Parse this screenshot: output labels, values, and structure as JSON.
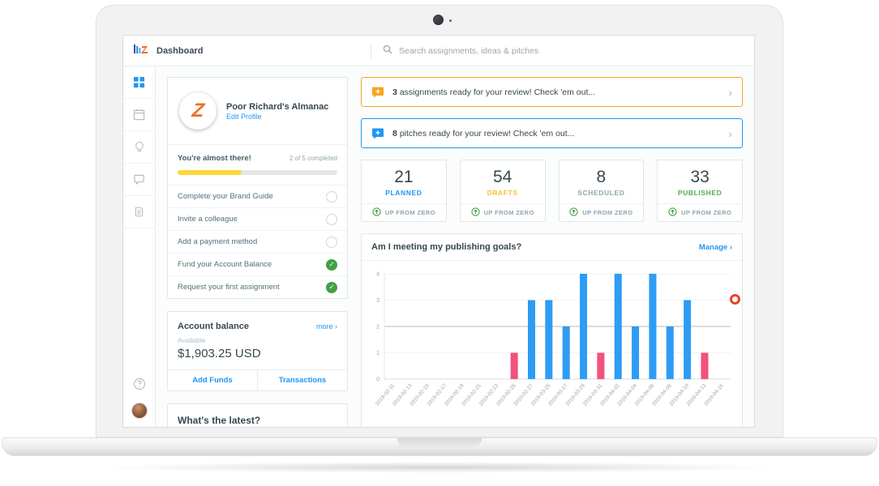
{
  "topbar": {
    "page_title": "Dashboard",
    "search_placeholder": "Search assignments, ideas & pitches"
  },
  "sidebar": {
    "items": [
      "dashboard",
      "calendar",
      "ideas",
      "pitches",
      "assignments"
    ],
    "active_item": "dashboard"
  },
  "profile_card": {
    "name": "Poor Richard's Almanac",
    "edit_link": "Edit Profile",
    "progress_title": "You're almost there!",
    "progress_status": "2 of 5 completed",
    "progress_percent": 40,
    "checklist": [
      {
        "label": "Complete your Brand Guide",
        "done": false
      },
      {
        "label": "Invite a colleague",
        "done": false
      },
      {
        "label": "Add a payment method",
        "done": false
      },
      {
        "label": "Fund your Account Balance",
        "done": true
      },
      {
        "label": "Request your first assignment",
        "done": true
      }
    ]
  },
  "balance_card": {
    "title": "Account balance",
    "more_link": "more ›",
    "available_label": "Available",
    "amount": "$1,903.25 USD",
    "buttons": {
      "add_funds": "Add Funds",
      "transactions": "Transactions"
    }
  },
  "latest_card": {
    "title": "What's the latest?"
  },
  "alerts": [
    {
      "count": "3",
      "text": "assignments ready for your review! Check 'em out...",
      "accent": "#f5a623"
    },
    {
      "count": "8",
      "text": "pitches ready for your review! Check 'em out...",
      "accent": "#2196f3"
    }
  ],
  "stats": [
    {
      "value": "21",
      "label": "PLANNED",
      "color": "#2196f3",
      "note": "UP FROM ZERO"
    },
    {
      "value": "54",
      "label": "DRAFTS",
      "color": "#fbc02d",
      "note": "UP FROM ZERO"
    },
    {
      "value": "8",
      "label": "SCHEDULED",
      "color": "#90a4ae",
      "note": "UP FROM ZERO"
    },
    {
      "value": "33",
      "label": "PUBLISHED",
      "color": "#4caf50",
      "note": "UP FROM ZERO"
    }
  ],
  "chart_card": {
    "title": "Am I meeting my publishing goals?",
    "manage_link": "Manage ›"
  },
  "chart_data": {
    "type": "bar",
    "title": "Am I meeting my publishing goals?",
    "xlabel": "",
    "ylabel": "",
    "ylim": [
      0,
      4
    ],
    "yticks": [
      0,
      1,
      2,
      3,
      4
    ],
    "goal_line": 2,
    "grid": "horizontal-light",
    "legend": false,
    "categories": [
      "2019-02-11",
      "2019-02-13",
      "2019-02-15",
      "2019-02-17",
      "2019-02-19",
      "2019-02-21",
      "2019-02-23",
      "2019-02-25",
      "2019-02-27",
      "2019-03-25",
      "2019-03-27",
      "2019-03-29",
      "2019-03-31",
      "2019-04-02",
      "2019-04-04",
      "2019-04-06",
      "2019-04-08",
      "2019-04-10",
      "2019-04-12",
      "2019-04-16"
    ],
    "values": [
      0,
      0,
      0,
      0,
      0,
      0,
      0,
      1,
      3,
      3,
      2,
      4,
      1,
      4,
      2,
      4,
      2,
      3,
      1,
      0
    ],
    "bar_colors": [
      "#2e9cf4",
      "#2e9cf4",
      "#2e9cf4",
      "#2e9cf4",
      "#2e9cf4",
      "#2e9cf4",
      "#2e9cf4",
      "#f2527c",
      "#2e9cf4",
      "#2e9cf4",
      "#2e9cf4",
      "#2e9cf4",
      "#f2527c",
      "#2e9cf4",
      "#2e9cf4",
      "#2e9cf4",
      "#2e9cf4",
      "#2e9cf4",
      "#f2527c",
      "#2e9cf4"
    ],
    "palette": {
      "on_goal": "#2e9cf4",
      "missed": "#f2527c",
      "goal_line": "#b7bcc1"
    }
  }
}
